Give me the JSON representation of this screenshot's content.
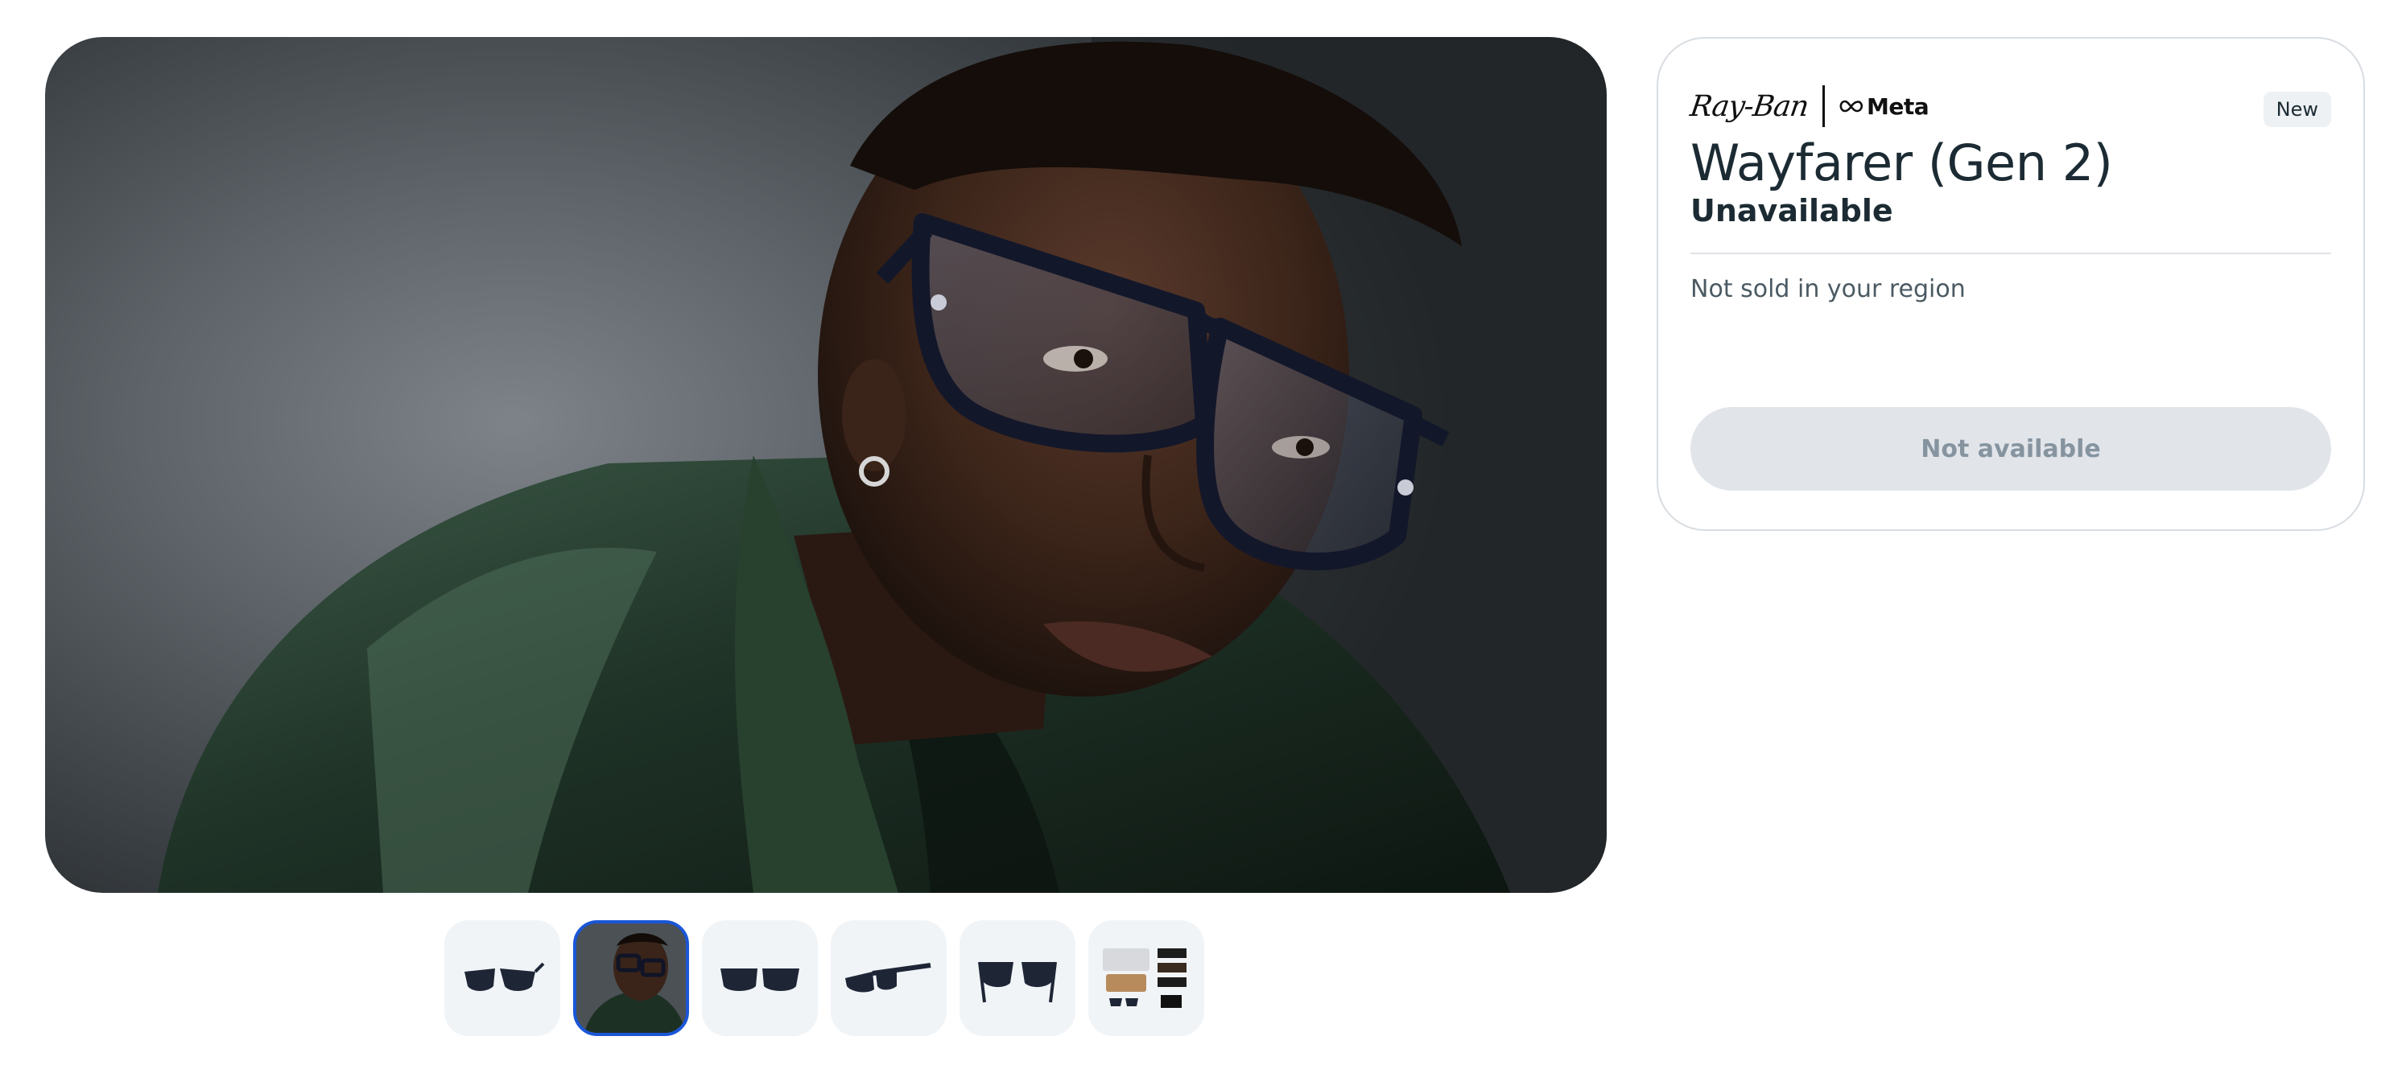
{
  "product": {
    "brand_primary": "Ray-Ban",
    "brand_secondary": "Meta",
    "badge": "New",
    "name": "Wayfarer (Gen 2)",
    "availability": "Unavailable",
    "region_note": "Not sold in your region",
    "cta_label": "Not available"
  },
  "gallery": {
    "main_image": "man-wearing-smart-glasses",
    "selected_index": 1,
    "thumbnails": [
      {
        "icon": "glasses-angled-left"
      },
      {
        "icon": "model-portrait"
      },
      {
        "icon": "glasses-front"
      },
      {
        "icon": "glasses-side"
      },
      {
        "icon": "glasses-back"
      },
      {
        "icon": "box-contents"
      }
    ]
  },
  "colors": {
    "accent_selected": "#1a56d6",
    "cta_disabled_bg": "#e1e5ea",
    "cta_disabled_text": "#8694a0",
    "text_primary": "#1c2b33"
  }
}
